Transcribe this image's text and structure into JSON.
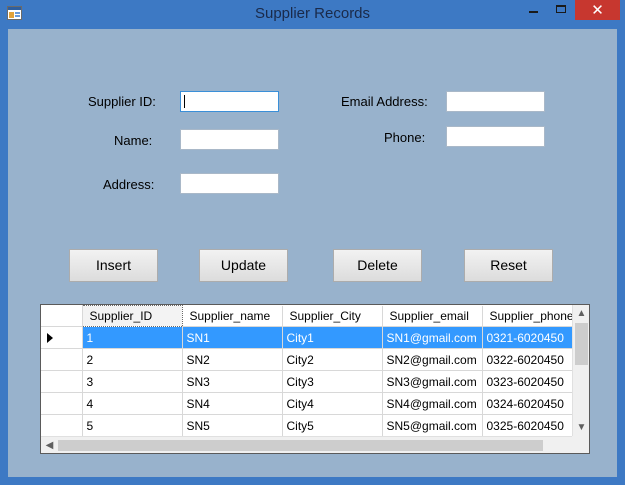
{
  "window": {
    "title": "Supplier Records",
    "close_glyph": "✕"
  },
  "form": {
    "supplier_id_label": "Supplier ID:",
    "name_label": "Name:",
    "address_label": "Address:",
    "email_label": "Email Address:",
    "phone_label": "Phone:",
    "supplier_id_value": "",
    "name_value": "",
    "address_value": "",
    "email_value": "",
    "phone_value": ""
  },
  "buttons": {
    "insert": "Insert",
    "update": "Update",
    "delete": "Delete",
    "reset": "Reset"
  },
  "grid": {
    "columns": [
      "Supplier_ID",
      "Supplier_name",
      "Supplier_City",
      "Supplier_email",
      "Supplier_phone"
    ],
    "rows": [
      [
        "1",
        "SN1",
        "City1",
        "SN1@gmail.com",
        "0321-6020450"
      ],
      [
        "2",
        "SN2",
        "City2",
        "SN2@gmail.com",
        "0322-6020450"
      ],
      [
        "3",
        "SN3",
        "City3",
        "SN3@gmail.com",
        "0323-6020450"
      ],
      [
        "4",
        "SN4",
        "City4",
        "SN4@gmail.com",
        "0324-6020450"
      ],
      [
        "5",
        "SN5",
        "City5",
        "SN5@gmail.com",
        "0325-6020450"
      ]
    ],
    "selected_row": 0
  },
  "icons": {
    "app": "app-icon",
    "minimize": "minimize-icon",
    "maximize": "maximize-icon",
    "close": "close-icon",
    "current_row": "current-row-arrow-icon"
  },
  "colors": {
    "title_bar": "#3d79c4",
    "form_background": "#98b2cc",
    "close_button": "#c7372f",
    "selection": "#3399ff"
  }
}
